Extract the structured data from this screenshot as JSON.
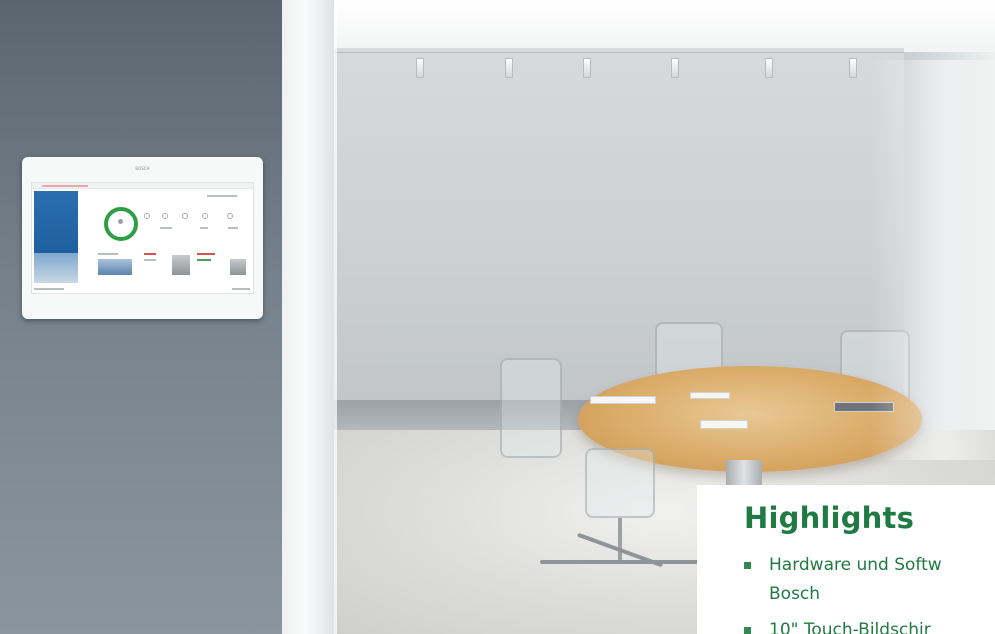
{
  "device": {
    "brand_label": "BOSCH"
  },
  "highlights": {
    "title": "Highlights",
    "items": [
      {
        "line1": "Hardware und Softw",
        "line2": "Bosch"
      },
      {
        "line1": "10\" Touch-Bildschir"
      }
    ]
  },
  "colors": {
    "accent_green": "#1f7a43",
    "status_ring": "#2e9e45",
    "wall_grey": "#6b7780"
  }
}
